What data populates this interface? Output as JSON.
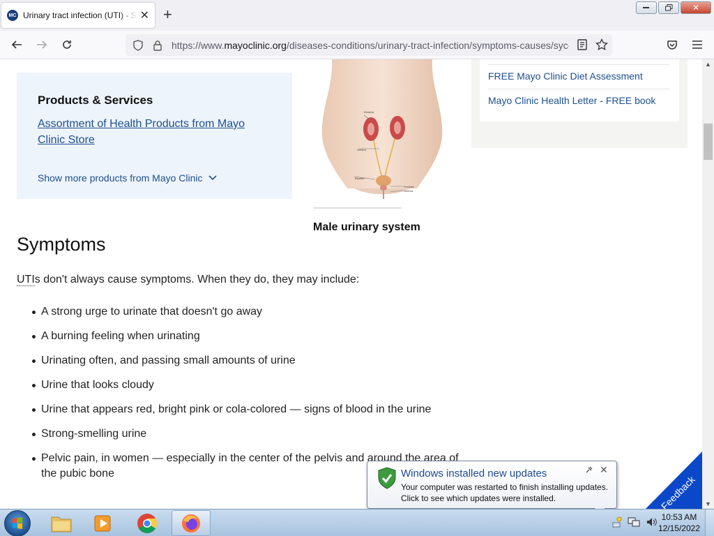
{
  "browser": {
    "tab_title": "Urinary tract infection (UTI) - Symptoms and causes - Mayo Clinic",
    "tab_close": "✕",
    "new_tab": "+",
    "url_prefix": "https://www.",
    "url_domain": "mayoclinic.org",
    "url_path": "/diseases-conditions/urinary-tract-infection/symptoms-causes/syc-"
  },
  "products": {
    "title": "Products & Services",
    "link": "Assortment of Health Products from Mayo Clinic Store",
    "more": "Show more products from Mayo Clinic"
  },
  "figure": {
    "caption": "Male urinary system",
    "labels": [
      "Kidneys",
      "Ureters",
      "Bladder",
      "Prostate",
      "Urethra"
    ]
  },
  "promo": {
    "links": [
      "FREE Mayo Clinic Diet Assessment",
      "Mayo Clinic Health Letter - FREE book"
    ]
  },
  "content": {
    "heading": "Symptoms",
    "intro_abbr": "UTI",
    "intro_rest": "s don't always cause symptoms. When they do, they may include:",
    "symptoms": [
      "A strong urge to urinate that doesn't go away",
      "A burning feeling when urinating",
      "Urinating often, and passing small amounts of urine",
      "Urine that looks cloudy",
      "Urine that appears red, bright pink or cola-colored — signs of blood in the urine",
      "Strong-smelling urine",
      "Pelvic pain, in women — especially in the center of the pelvis and around the area of the pubic bone"
    ]
  },
  "feedback": {
    "label": "Feedback",
    "color": "#0a47c9"
  },
  "notification": {
    "title": "Windows installed new updates",
    "line1": "Your computer was restarted to finish installing updates.",
    "line2": "Click to see which updates were installed.",
    "close": "✕"
  },
  "taskbar": {
    "items": [
      "windows-explorer",
      "media-player",
      "google-chrome",
      "firefox"
    ],
    "time": "10:53 AM",
    "date": "12/15/2022"
  }
}
